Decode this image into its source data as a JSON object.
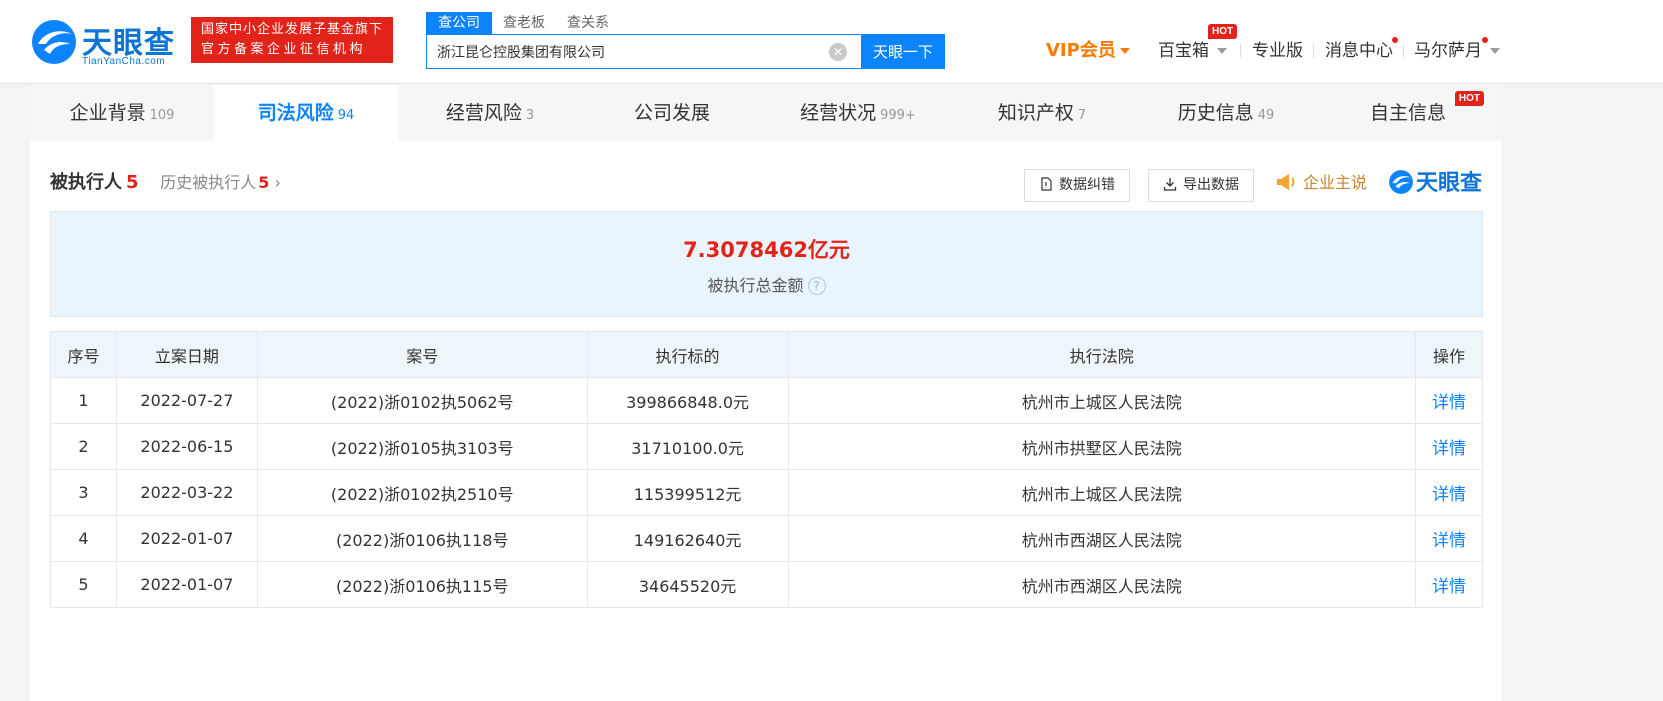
{
  "brand": {
    "name": "天眼查",
    "domain": "TianYanCha.com",
    "badge_line1": "国家中小企业发展子基金旗下",
    "badge_line2": "官方备案企业征信机构"
  },
  "search": {
    "tabs": [
      "查公司",
      "查老板",
      "查关系"
    ],
    "value": "浙江昆仑控股集团有限公司",
    "button": "天眼一下"
  },
  "topnav": {
    "vip": "VIP会员",
    "treasure": "百宝箱",
    "hot": "HOT",
    "pro": "专业版",
    "messages": "消息中心",
    "user": "马尔萨月"
  },
  "tabs": [
    {
      "label": "企业背景",
      "count": "109"
    },
    {
      "label": "司法风险",
      "count": "94"
    },
    {
      "label": "经营风险",
      "count": "3"
    },
    {
      "label": "公司发展",
      "count": ""
    },
    {
      "label": "经营状况",
      "count": "999+"
    },
    {
      "label": "知识产权",
      "count": "7"
    },
    {
      "label": "历史信息",
      "count": "49"
    },
    {
      "label": "自主信息",
      "count": ""
    }
  ],
  "tab_hot": "HOT",
  "section": {
    "title": "被执行人",
    "count": "5",
    "history_label": "历史被执行人",
    "history_count": "5",
    "btn_correct": "数据纠错",
    "btn_export": "导出数据",
    "speak": "企业主说",
    "brand": "天眼查"
  },
  "summary": {
    "value": "7.3078462亿元",
    "label": "被执行总金额"
  },
  "table": {
    "headers": [
      "序号",
      "立案日期",
      "案号",
      "执行标的",
      "执行法院",
      "操作"
    ],
    "rows": [
      [
        "1",
        "2022-07-27",
        "(2022)浙0102执5062号",
        "399866848.0元",
        "杭州市上城区人民法院",
        "详情"
      ],
      [
        "2",
        "2022-06-15",
        "(2022)浙0105执3103号",
        "31710100.0元",
        "杭州市拱墅区人民法院",
        "详情"
      ],
      [
        "3",
        "2022-03-22",
        "(2022)浙0102执2510号",
        "115399512元",
        "杭州市上城区人民法院",
        "详情"
      ],
      [
        "4",
        "2022-01-07",
        "(2022)浙0106执118号",
        "149162640元",
        "杭州市西湖区人民法院",
        "详情"
      ],
      [
        "5",
        "2022-01-07",
        "(2022)浙0106执115号",
        "34645520元",
        "杭州市西湖区人民法院",
        "详情"
      ]
    ]
  }
}
